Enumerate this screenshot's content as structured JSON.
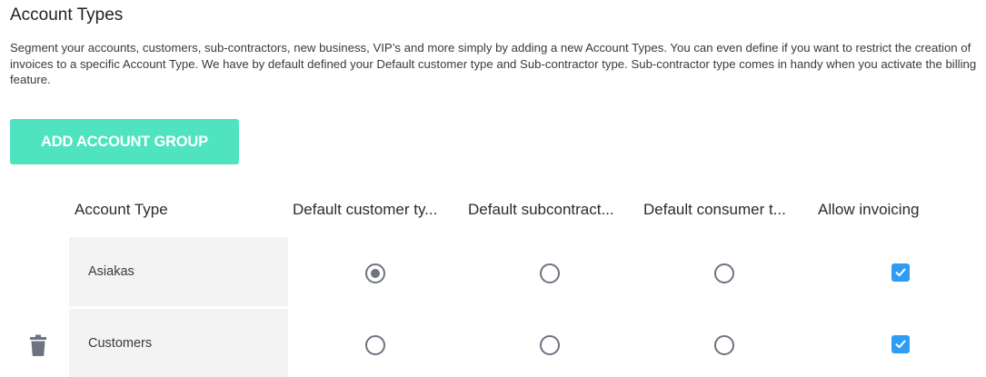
{
  "header": {
    "title": "Account Types",
    "description": "Segment your accounts, customers, sub-contractors, new business, VIP’s and more simply by adding a new Account Types. You can even define if you want to restrict the creation of invoices to a specific Account Type. We have by default defined your Default customer type and Sub-contractor type. Sub-contractor type comes in handy when you activate the billing feature."
  },
  "actions": {
    "add_label": "ADD ACCOUNT GROUP"
  },
  "table": {
    "columns": [
      "Account Type",
      "Default customer ty...",
      "Default subcontract...",
      "Default consumer t...",
      "Allow invoicing"
    ],
    "rows": [
      {
        "name": "Asiakas",
        "default_customer": true,
        "default_subcontractor": false,
        "default_consumer": false,
        "allow_invoicing": true,
        "deletable": false
      },
      {
        "name": "Customers",
        "default_customer": false,
        "default_subcontractor": false,
        "default_consumer": false,
        "allow_invoicing": true,
        "deletable": true
      }
    ]
  },
  "icons": {
    "delete": "trash-icon",
    "checked": "checkmark-icon"
  },
  "colors": {
    "accent_button": "#4fe3c0",
    "checkbox": "#2f9cf4",
    "radio": "#6d7380",
    "row_background": "#f3f3f3",
    "icon": "#6d7380"
  }
}
